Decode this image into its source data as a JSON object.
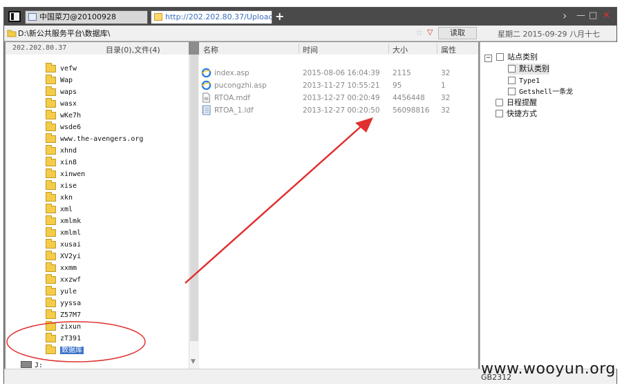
{
  "tabs": [
    {
      "label": "中国菜刀@20100928",
      "active": false
    },
    {
      "label": "http://202.202.80.37/Upload...",
      "active": true
    }
  ],
  "new_tab_label": "+",
  "window_controls": {
    "next": "›",
    "minimize": "—",
    "maximize": "□",
    "close": "✕"
  },
  "address": {
    "path": "D:\\新公共服务平台\\数据库\\",
    "read_button": "读取",
    "date": "星期二 2015-09-29 八月十七"
  },
  "left_panel": {
    "ip": "202.202.80.37",
    "count": "目录(0),文件(4)",
    "folders": [
      "vefw",
      "Wap",
      "waps",
      "wasx",
      "wKe7h",
      "wsde6",
      "www.the-avengers.org",
      "xhnd",
      "xin8",
      "xinwen",
      "xise",
      "xkn",
      "xml",
      "xmlmk",
      "xmlml",
      "xusai",
      "XV2yi",
      "xxmm",
      "xxzwf",
      "yule",
      "yyssa",
      "Z57M7",
      "zixun",
      "zT391",
      "数据库"
    ],
    "selected": "数据库",
    "drive": "J:"
  },
  "file_list": {
    "columns": {
      "name": "名称",
      "time": "时间",
      "size": "大小",
      "attr": "属性"
    },
    "rows": [
      {
        "name": "index.asp",
        "time": "2015-08-06 16:04:39",
        "size": "2115",
        "attr": "32",
        "icon": "ie-icon"
      },
      {
        "name": "pucongzhi.asp",
        "time": "2013-11-27 10:55:21",
        "size": "95",
        "attr": "1",
        "icon": "ie-icon"
      },
      {
        "name": "RTOA.mdf",
        "time": "2013-12-27 00:20:49",
        "size": "4456448",
        "attr": "32",
        "icon": "file-icon"
      },
      {
        "name": "RTOA_1.ldf",
        "time": "2013-12-27 00:20:50",
        "size": "56098816",
        "attr": "32",
        "icon": "notebook-icon"
      }
    ]
  },
  "right_panel": {
    "site_category": "站点类别",
    "default_category": "默认类别",
    "type1": "Type1",
    "getshell": "Getshell一条龙",
    "schedule": "日程提醒",
    "shortcuts": "快捷方式"
  },
  "status": {
    "encoding": "GB2312"
  },
  "watermark": "www.wooyun.org",
  "colors": {
    "annotation_red": "#e03030",
    "selection_blue": "#3a73c9"
  }
}
